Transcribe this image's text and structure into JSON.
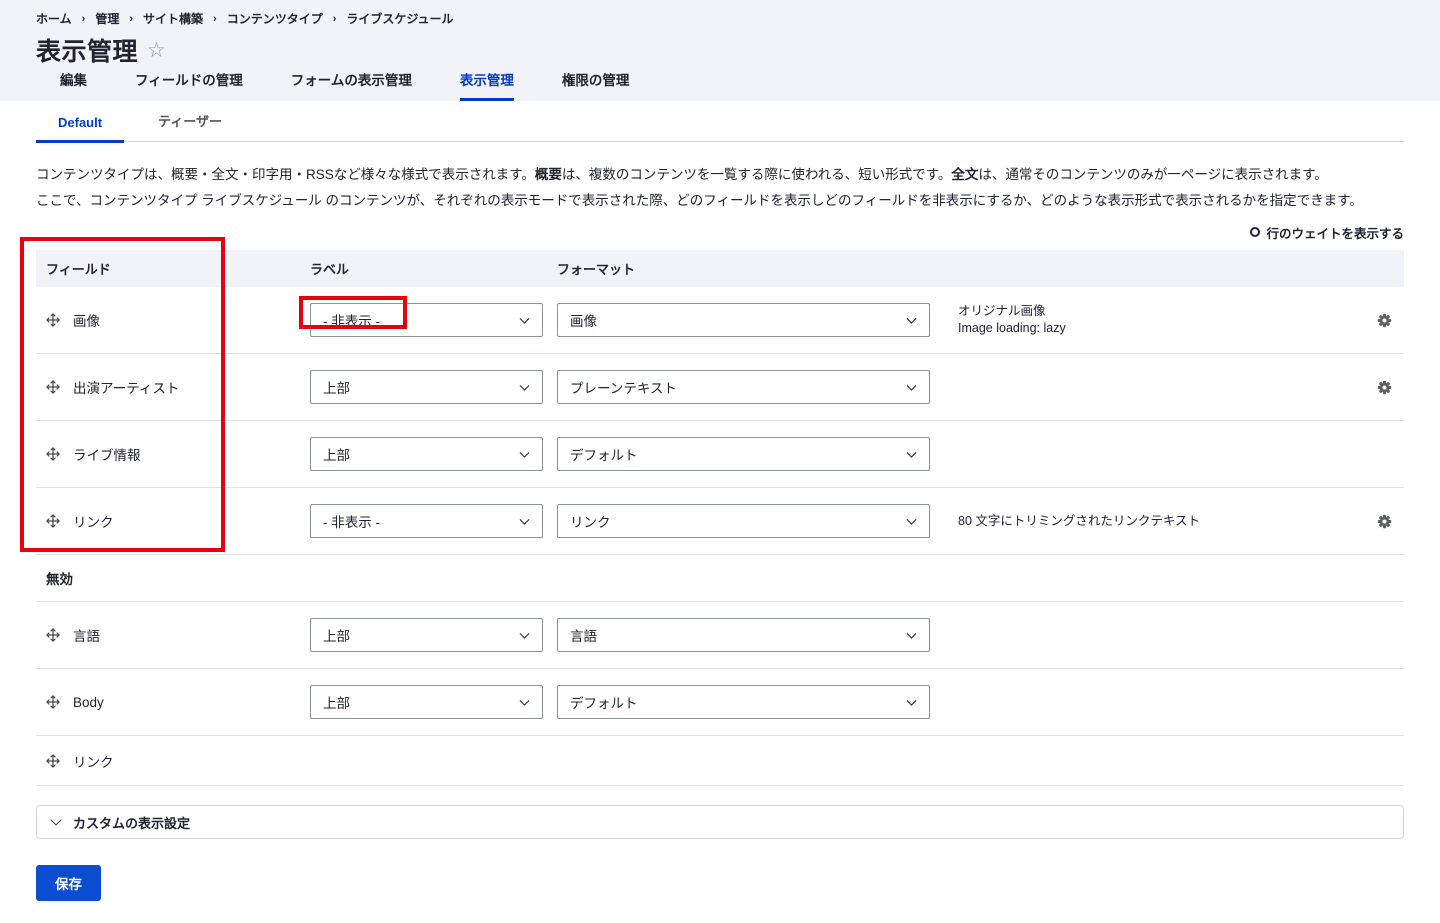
{
  "colors": {
    "accent": "#003cc5",
    "annotation": "#e8000d",
    "save_bg": "#0b4dd1",
    "header_bg": "#f2f3f8"
  },
  "breadcrumb": {
    "separator": "›",
    "items": [
      "ホーム",
      "管理",
      "サイト構築",
      "コンテンツタイプ",
      "ライブスケジュール"
    ]
  },
  "page": {
    "title": "表示管理",
    "star": "☆"
  },
  "primary_tabs": [
    {
      "label": "編集",
      "active": false
    },
    {
      "label": "フィールドの管理",
      "active": false
    },
    {
      "label": "フォームの表示管理",
      "active": false
    },
    {
      "label": "表示管理",
      "active": true
    },
    {
      "label": "権限の管理",
      "active": false
    }
  ],
  "secondary_tabs": [
    {
      "label": "Default",
      "active": true
    },
    {
      "label": "ティーザー",
      "active": false
    }
  ],
  "description": {
    "p1": [
      {
        "t": "コンテンツタイプは、概要・全文・印字用・RSSなど様々な様式で表示されます。",
        "b": false
      },
      {
        "t": "概要",
        "b": true
      },
      {
        "t": "は、複数のコンテンツを一覧する際に使われる、短い形式です。",
        "b": false
      },
      {
        "t": "全文",
        "b": true
      },
      {
        "t": "は、通常そのコンテンツのみが一ページに表示されます。",
        "b": false
      }
    ],
    "p2": "ここで、コンテンツタイプ ライブスケジュール のコンテンツが、それぞれの表示モードで表示された際、どのフィールドを表示しどのフィールドを非表示にするか、どのような表示形式で表示されるかを指定できます。"
  },
  "row_weights_link": {
    "label": "行のウェイトを表示する"
  },
  "table": {
    "headers": [
      "フィールド",
      "ラベル",
      "フォーマット"
    ],
    "rows": [
      {
        "field": "画像",
        "label_value": "- 非表示 -",
        "format_value": "画像",
        "summary": [
          "オリジナル画像",
          "Image loading: lazy"
        ],
        "has_settings": true
      },
      {
        "field": "出演アーティスト",
        "label_value": "上部",
        "format_value": "プレーンテキスト",
        "summary": [],
        "has_settings": true
      },
      {
        "field": "ライブ情報",
        "label_value": "上部",
        "format_value": "デフォルト",
        "summary": [],
        "has_settings": false
      },
      {
        "field": "リンク",
        "label_value": "- 非表示 -",
        "format_value": "リンク",
        "summary": [
          "80 文字にトリミングされたリンクテキスト"
        ],
        "has_settings": true
      }
    ],
    "disabled_label": "無効",
    "disabled_rows": [
      {
        "field": "言語",
        "label_value": "上部",
        "format_value": "言語",
        "summary": [],
        "has_settings": false
      },
      {
        "field": "Body",
        "label_value": "上部",
        "format_value": "デフォルト",
        "summary": [],
        "has_settings": false
      },
      {
        "field": "リンク",
        "label_value": null,
        "format_value": null,
        "summary": [],
        "has_settings": false
      }
    ]
  },
  "custom_display_settings": {
    "label": "カスタムの表示設定"
  },
  "save_button": {
    "label": "保存"
  }
}
